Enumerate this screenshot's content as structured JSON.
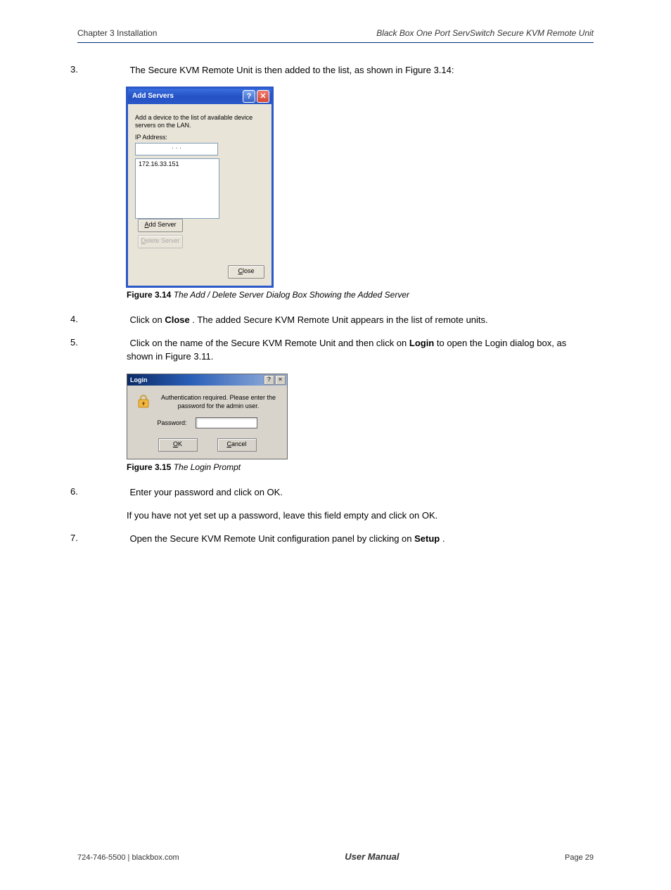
{
  "header": {
    "chapter": "Chapter 3 Installation",
    "product": "Black Box One Port ServSwitch Secure KVM Remote Unit"
  },
  "steps": {
    "s3": {
      "num": "3.",
      "text": "The Secure KVM Remote Unit is then added to the list, as shown in ",
      "ref": "Figure 3.14",
      "after": ":"
    },
    "s4": {
      "num": "4.",
      "text_a": "Click on ",
      "bold": "Close",
      "text_b": ". The added Secure KVM Remote Unit appears in the list of remote units."
    },
    "s5": {
      "num": "5.",
      "text_a": "Click on the name of the Secure KVM Remote Unit and then click on ",
      "bold": "Login",
      "text_b": " to open the Login dialog box, as shown in ",
      "ref": "Figure 3.11",
      "after": "."
    },
    "s6": {
      "num": "6.",
      "text": "Enter your password and click on OK."
    },
    "s6_note": "If you have not yet set up a password, leave this field empty and click on OK.",
    "s7": {
      "num": "7.",
      "text_a": "Open the Secure KVM Remote Unit configuration panel by clicking on ",
      "bold": "Setup",
      "text_b": "."
    }
  },
  "figures": {
    "f314": {
      "label": "Figure 3.14",
      "caption": "The Add / Delete Server Dialog Box Showing the Added Server"
    },
    "f315": {
      "label": "Figure 3.15",
      "caption": "The Login Prompt"
    }
  },
  "dialog1": {
    "title": "Add Servers",
    "desc": "Add a device to the list of available device servers on the LAN.",
    "ip_label": "IP Address:",
    "ip_placeholder": "·       ·       ·",
    "list_item": "172.16.33.151",
    "btn_add": "Add Server",
    "btn_delete": "Delete Server",
    "btn_close": "Close"
  },
  "dialog2": {
    "title": "Login",
    "msg": "Authentication required. Please enter the password for the admin user.",
    "pw_label": "Password:",
    "btn_ok": "OK",
    "btn_cancel": "Cancel"
  },
  "footer": {
    "left": "724-746-5500  | blackbox.com",
    "center": "User Manual",
    "right": "Page 29"
  }
}
